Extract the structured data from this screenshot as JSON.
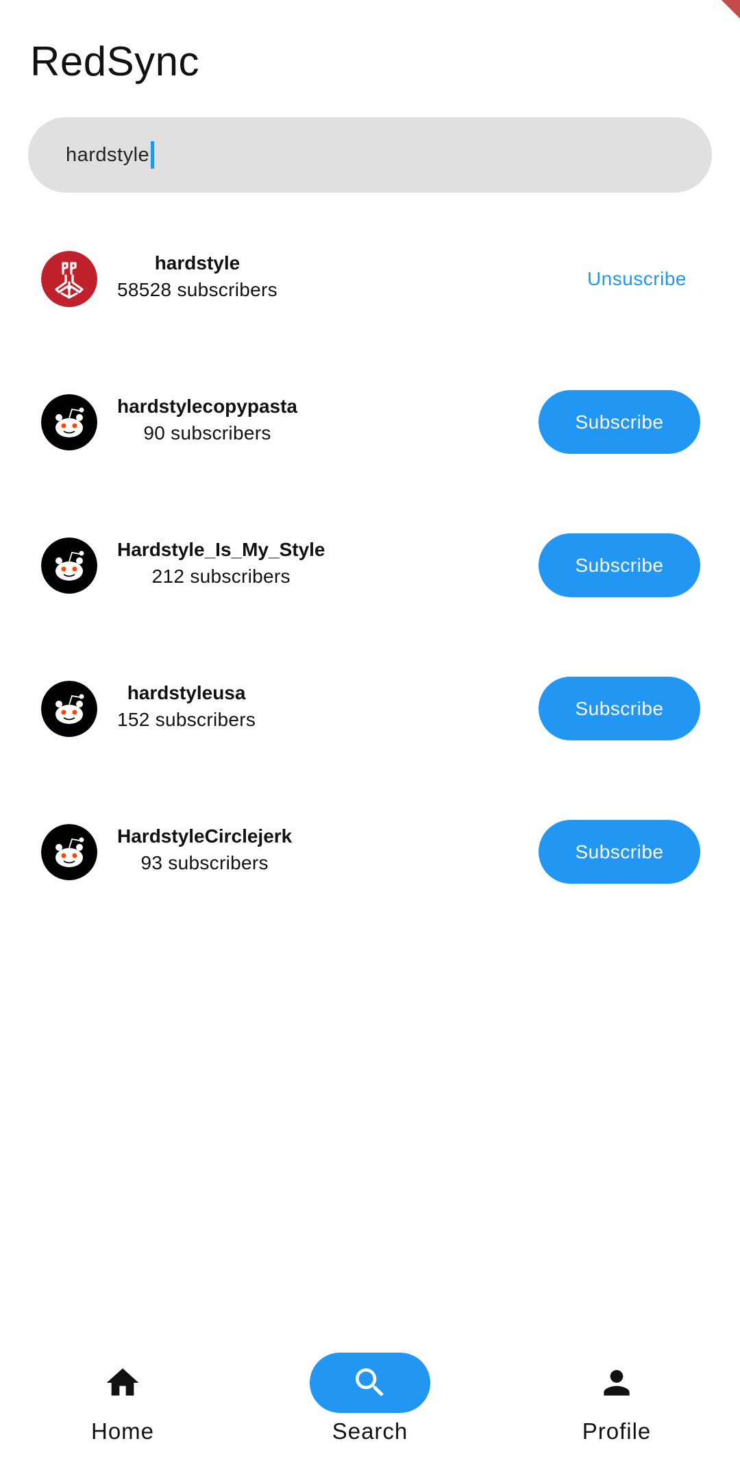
{
  "app": {
    "title": "RedSync"
  },
  "search": {
    "value": "hardstyle"
  },
  "results": [
    {
      "name": "hardstyle",
      "subscribers": "58528 subscribers",
      "action": "Unsuscribe",
      "icon": "hardstyle-logo-icon",
      "subscribed": true
    },
    {
      "name": "hardstylecopypasta",
      "subscribers": "90 subscribers",
      "action": "Subscribe",
      "icon": "reddit-alien-icon",
      "subscribed": false
    },
    {
      "name": "Hardstyle_Is_My_Style",
      "subscribers": "212 subscribers",
      "action": "Subscribe",
      "icon": "reddit-alien-icon",
      "subscribed": false
    },
    {
      "name": "hardstyleusa",
      "subscribers": "152 subscribers",
      "action": "Subscribe",
      "icon": "reddit-alien-icon",
      "subscribed": false
    },
    {
      "name": "HardstyleCirclejerk",
      "subscribers": "93 subscribers",
      "action": "Subscribe",
      "icon": "reddit-alien-icon",
      "subscribed": false
    }
  ],
  "nav": {
    "items": [
      {
        "label": "Home",
        "icon": "home-icon",
        "active": false
      },
      {
        "label": "Search",
        "icon": "search-icon",
        "active": true
      },
      {
        "label": "Profile",
        "icon": "person-icon",
        "active": false
      }
    ]
  },
  "colors": {
    "accent": "#2196f3",
    "search_bg": "#e0e0e0",
    "hardstyle_logo": "#c0222b"
  }
}
